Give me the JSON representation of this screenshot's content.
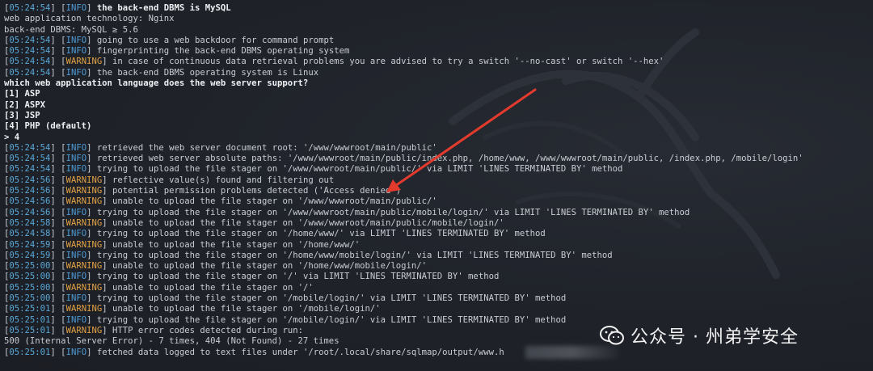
{
  "terminal": {
    "lines": [
      {
        "ts": "05:24:54",
        "level": "INFO",
        "msg": "the back-end DBMS is MySQL",
        "bold": true
      },
      {
        "plain": "web application technology: Nginx"
      },
      {
        "plain": "back-end DBMS: MySQL ≥ 5.6"
      },
      {
        "ts": "05:24:54",
        "level": "INFO",
        "msg": "going to use a web backdoor for command prompt"
      },
      {
        "ts": "05:24:54",
        "level": "INFO",
        "msg": "fingerprinting the back-end DBMS operating system"
      },
      {
        "ts": "05:24:54",
        "level": "WARNING",
        "msg": "in case of continuous data retrieval problems you are advised to try a switch '--no-cast' or switch '--hex'"
      },
      {
        "ts": "05:24:54",
        "level": "INFO",
        "msg": "the back-end DBMS operating system is Linux"
      },
      {
        "plain": "which web application language does the web server support?",
        "bold": true
      },
      {
        "plain": "[1] ASP",
        "bold": true
      },
      {
        "plain": "[2] ASPX",
        "bold": true
      },
      {
        "plain": "[3] JSP",
        "bold": true
      },
      {
        "plain": "[4] PHP (default)",
        "bold": true
      },
      {
        "plain": "> 4",
        "bold": true
      },
      {
        "ts": "05:24:54",
        "level": "INFO",
        "msg": "retrieved the web server document root: '/www/wwwroot/main/public'"
      },
      {
        "ts": "05:24:54",
        "level": "INFO",
        "msg": "retrieved web server absolute paths: '/www/wwwroot/main/public/index.php, /home/www, /www/wwwroot/main/public, /index.php, /mobile/login'"
      },
      {
        "ts": "05:24:54",
        "level": "INFO",
        "msg": "trying to upload the file stager on '/www/wwwroot/main/public/' via LIMIT 'LINES TERMINATED BY' method"
      },
      {
        "ts": "05:24:56",
        "level": "WARNING",
        "msg": "reflective value(s) found and filtering out"
      },
      {
        "ts": "05:24:56",
        "level": "WARNING",
        "msg": "potential permission problems detected ('Access denied')"
      },
      {
        "ts": "05:24:56",
        "level": "WARNING",
        "msg": "unable to upload the file stager on '/www/wwwroot/main/public/'"
      },
      {
        "ts": "05:24:56",
        "level": "INFO",
        "msg": "trying to upload the file stager on '/www/wwwroot/main/public/mobile/login/' via LIMIT 'LINES TERMINATED BY' method"
      },
      {
        "ts": "05:24:58",
        "level": "WARNING",
        "msg": "unable to upload the file stager on '/www/wwwroot/main/public/mobile/login/'"
      },
      {
        "ts": "05:24:58",
        "level": "INFO",
        "msg": "trying to upload the file stager on '/home/www/' via LIMIT 'LINES TERMINATED BY' method"
      },
      {
        "ts": "05:24:59",
        "level": "WARNING",
        "msg": "unable to upload the file stager on '/home/www/'"
      },
      {
        "ts": "05:24:59",
        "level": "INFO",
        "msg": "trying to upload the file stager on '/home/www/mobile/login/' via LIMIT 'LINES TERMINATED BY' method"
      },
      {
        "ts": "05:25:00",
        "level": "WARNING",
        "msg": "unable to upload the file stager on '/home/www/mobile/login/'"
      },
      {
        "ts": "05:25:00",
        "level": "INFO",
        "msg": "trying to upload the file stager on '/' via LIMIT 'LINES TERMINATED BY' method"
      },
      {
        "ts": "05:25:00",
        "level": "WARNING",
        "msg": "unable to upload the file stager on '/'"
      },
      {
        "ts": "05:25:00",
        "level": "INFO",
        "msg": "trying to upload the file stager on '/mobile/login/' via LIMIT 'LINES TERMINATED BY' method"
      },
      {
        "ts": "05:25:01",
        "level": "WARNING",
        "msg": "unable to upload the file stager on '/mobile/login/'"
      },
      {
        "ts": "05:25:01",
        "level": "INFO",
        "msg": "trying to upload the file stager on '/mobile/login/' via LIMIT 'LINES TERMINATED BY' method"
      },
      {
        "ts": "05:25:01",
        "level": "WARNING",
        "msg": "HTTP error codes detected during run:"
      },
      {
        "plain": "500 (Internal Server Error) - 7 times, 404 (Not Found) - 27 times"
      },
      {
        "ts": "05:25:01",
        "level": "INFO",
        "msg": "fetched data logged to text files under '/root/.local/share/sqlmap/output/www.h"
      }
    ]
  },
  "watermark": {
    "text": "公众号 · 州弟学安全",
    "icon": "wechat-icon"
  },
  "colors": {
    "background": "#1e2128",
    "timestamp": "#5aa8d8",
    "info": "#4e9bd4",
    "warning": "#e0a044",
    "text": "#c9cdd3",
    "arrow": "#e23b2e"
  }
}
